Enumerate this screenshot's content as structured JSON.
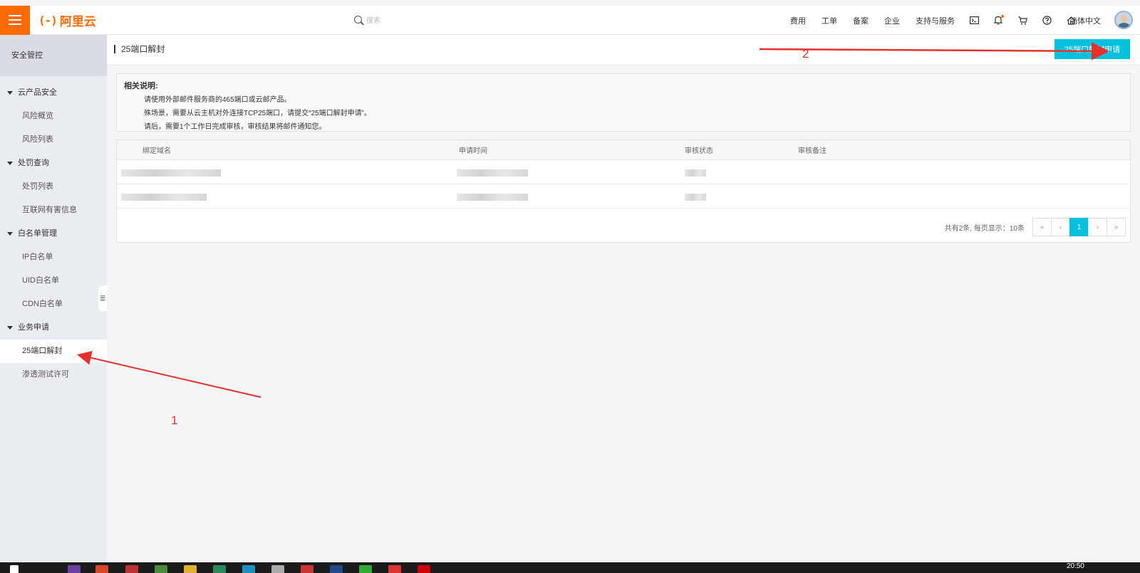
{
  "brand": {
    "mark": "(-)",
    "name": "阿里云"
  },
  "search": {
    "placeholder": "搜索"
  },
  "nav": [
    "费用",
    "工单",
    "备案",
    "企业",
    "支持与服务"
  ],
  "nav_icons": [
    "terminal-icon",
    "bell-icon",
    "cart-icon",
    "help-icon",
    "home-icon"
  ],
  "lang": "简体中文",
  "sidebar": {
    "title": "安全管控",
    "groups": [
      {
        "label": "云产品安全",
        "items": [
          "风险概览",
          "风险列表"
        ]
      },
      {
        "label": "处罚查询",
        "items": [
          "处罚列表",
          "互联网有害信息"
        ]
      },
      {
        "label": "白名单管理",
        "items": [
          "IP白名单",
          "UID白名单",
          "CDN白名单"
        ]
      },
      {
        "label": "业务申请",
        "items": [
          "25端口解封",
          "渗透测试许可"
        ]
      }
    ],
    "active": "25端口解封"
  },
  "page": {
    "title": "25端口解封",
    "apply_button": "25端口解封申请"
  },
  "notice": {
    "title": "相关说明:",
    "lines": [
      "请使用外部邮件服务商的465端口或云邮产品。",
      "殊场景，需要从云主机对外连接TCP25端口，请提交“25端口解封申请”。",
      "请后，需要1个工作日完成审核，审核结果将邮件通知您。"
    ]
  },
  "table": {
    "columns": [
      "绑定域名",
      "申请时间",
      "审核状态",
      "审核备注"
    ]
  },
  "pager": {
    "summary": "共有2条, 每页显示：10条",
    "first": "«",
    "prev": "‹",
    "current": "1",
    "next": "›",
    "last": "»"
  },
  "annotations": {
    "arrow1": "1",
    "arrow2": "2"
  },
  "colors": {
    "brand": "#ff6a00",
    "primary": "#00c1de",
    "annotation": "#e8302a"
  },
  "taskbar": {
    "time": "20:50"
  }
}
